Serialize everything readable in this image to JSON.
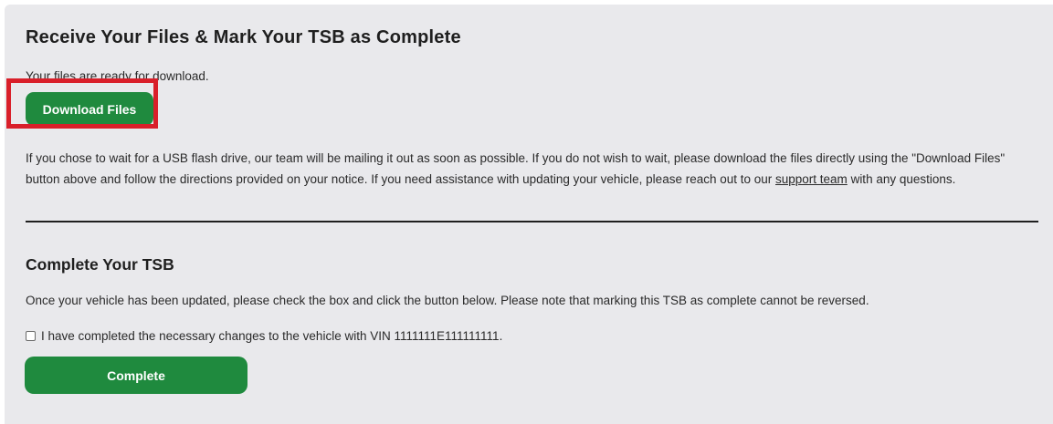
{
  "download_section": {
    "title": "Receive Your Files & Mark Your TSB as Complete",
    "ready_text": "Your files are ready for download.",
    "download_button": "Download Files",
    "info_part1": "If you chose to wait for a USB flash drive, our team will be mailing it out as soon as possible. If you do not wish to wait, please download the files directly using the \"Download Files\" button above and follow the directions provided on your notice. If you need assistance with updating your vehicle, please reach out to our ",
    "support_link": "support team",
    "info_part2": " with any questions."
  },
  "complete_section": {
    "title": "Complete Your TSB",
    "note": "Once your vehicle has been updated, please check the box and click the button below. Please note that marking this TSB as complete cannot be reversed.",
    "checkbox_label": "I have completed the necessary changes to the vehicle with VIN 1111111E111111111.",
    "checkbox_checked": false,
    "complete_button": "Complete"
  },
  "colors": {
    "panel_bg": "#e9e9ec",
    "button_green": "#1f8a3e",
    "highlight_red": "#d91f2a"
  }
}
